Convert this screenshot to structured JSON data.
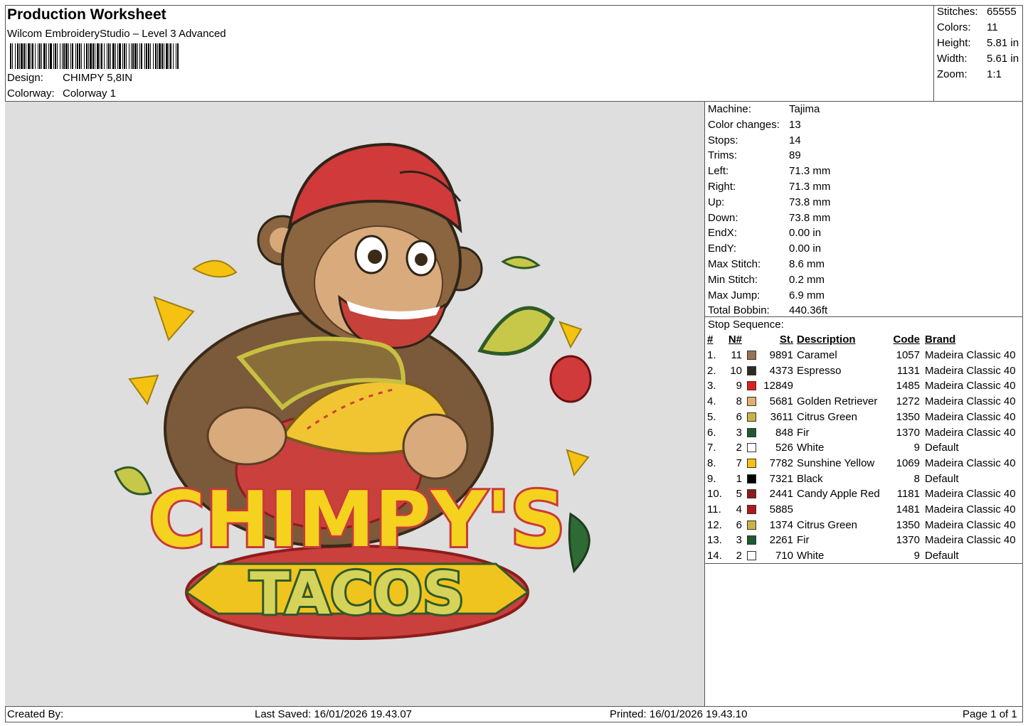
{
  "header": {
    "title": "Production Worksheet",
    "software": "Wilcom EmbroideryStudio – Level 3 Advanced",
    "design_label": "Design:",
    "design": "CHIMPY 5,8IN",
    "colorway_label": "Colorway:",
    "colorway": "Colorway 1"
  },
  "stats": [
    {
      "label": "Stitches:",
      "value": "65555"
    },
    {
      "label": "Colors:",
      "value": "11"
    },
    {
      "label": "Height:",
      "value": "5.81 in"
    },
    {
      "label": "Width:",
      "value": "5.61 in"
    },
    {
      "label": "Zoom:",
      "value": "1:1"
    }
  ],
  "machine_info": [
    {
      "label": "Machine:",
      "value": "Tajima"
    },
    {
      "label": "Color changes:",
      "value": "13"
    },
    {
      "label": "Stops:",
      "value": "14"
    },
    {
      "label": "Trims:",
      "value": "89"
    },
    {
      "label": "Left:",
      "value": "71.3 mm"
    },
    {
      "label": "Right:",
      "value": "71.3 mm"
    },
    {
      "label": "Up:",
      "value": "73.8 mm"
    },
    {
      "label": "Down:",
      "value": "73.8 mm"
    },
    {
      "label": "EndX:",
      "value": "0.00 in"
    },
    {
      "label": "EndY:",
      "value": "0.00 in"
    },
    {
      "label": "Max Stitch:",
      "value": "8.6 mm"
    },
    {
      "label": "Min Stitch:",
      "value": "0.2 mm"
    },
    {
      "label": "Max Jump:",
      "value": "6.9 mm"
    },
    {
      "label": "Total Bobbin:",
      "value": "440.36ft"
    }
  ],
  "stop_sequence": {
    "title": "Stop Sequence:",
    "headers": {
      "idx": "#",
      "n": "N#",
      "st": "St.",
      "desc": "Description",
      "code": "Code",
      "brand": "Brand"
    },
    "rows": [
      {
        "idx": "1.",
        "n": "11",
        "color": "#9a7352",
        "st": "9891",
        "desc": "Caramel",
        "code": "1057",
        "brand": "Madeira Classic 40"
      },
      {
        "idx": "2.",
        "n": "10",
        "color": "#2e2b20",
        "st": "4373",
        "desc": "Espresso",
        "code": "1131",
        "brand": "Madeira Classic 40"
      },
      {
        "idx": "3.",
        "n": "9",
        "color": "#e21d1d",
        "st": "12849",
        "desc": "",
        "code": "1485",
        "brand": "Madeira Classic 40"
      },
      {
        "idx": "4.",
        "n": "8",
        "color": "#e0b070",
        "st": "5681",
        "desc": "Golden Retriever",
        "code": "1272",
        "brand": "Madeira Classic 40"
      },
      {
        "idx": "5.",
        "n": "6",
        "color": "#c8b446",
        "st": "3611",
        "desc": "Citrus Green",
        "code": "1350",
        "brand": "Madeira Classic 40"
      },
      {
        "idx": "6.",
        "n": "3",
        "color": "#1d5a34",
        "st": "848",
        "desc": "Fir",
        "code": "1370",
        "brand": "Madeira Classic 40"
      },
      {
        "idx": "7.",
        "n": "2",
        "color": "#ffffff",
        "st": "526",
        "desc": "White",
        "code": "9",
        "brand": "Default"
      },
      {
        "idx": "8.",
        "n": "7",
        "color": "#f5c211",
        "st": "7782",
        "desc": "Sunshine Yellow",
        "code": "1069",
        "brand": "Madeira Classic 40"
      },
      {
        "idx": "9.",
        "n": "1",
        "color": "#000000",
        "st": "7321",
        "desc": "Black",
        "code": "8",
        "brand": "Default"
      },
      {
        "idx": "10.",
        "n": "5",
        "color": "#8b1a1f",
        "st": "2441",
        "desc": "Candy Apple Red",
        "code": "1181",
        "brand": "Madeira Classic 40"
      },
      {
        "idx": "11.",
        "n": "4",
        "color": "#b0171f",
        "st": "5885",
        "desc": "",
        "code": "1481",
        "brand": "Madeira Classic 40"
      },
      {
        "idx": "12.",
        "n": "6",
        "color": "#c8b446",
        "st": "1374",
        "desc": "Citrus Green",
        "code": "1350",
        "brand": "Madeira Classic 40"
      },
      {
        "idx": "13.",
        "n": "3",
        "color": "#1d5a34",
        "st": "2261",
        "desc": "Fir",
        "code": "1370",
        "brand": "Madeira Classic 40"
      },
      {
        "idx": "14.",
        "n": "2",
        "color": "#ffffff",
        "st": "710",
        "desc": "White",
        "code": "9",
        "brand": "Default"
      }
    ]
  },
  "design_preview": {
    "logo_text_1": "CHIMPY'S",
    "logo_text_2": "TACOS"
  },
  "footer": {
    "created_by": "Created By:",
    "last_saved": "Last Saved: 16/01/2026 19.43.07",
    "printed": "Printed: 16/01/2026 19.43.10",
    "page": "Page 1 of 1"
  }
}
